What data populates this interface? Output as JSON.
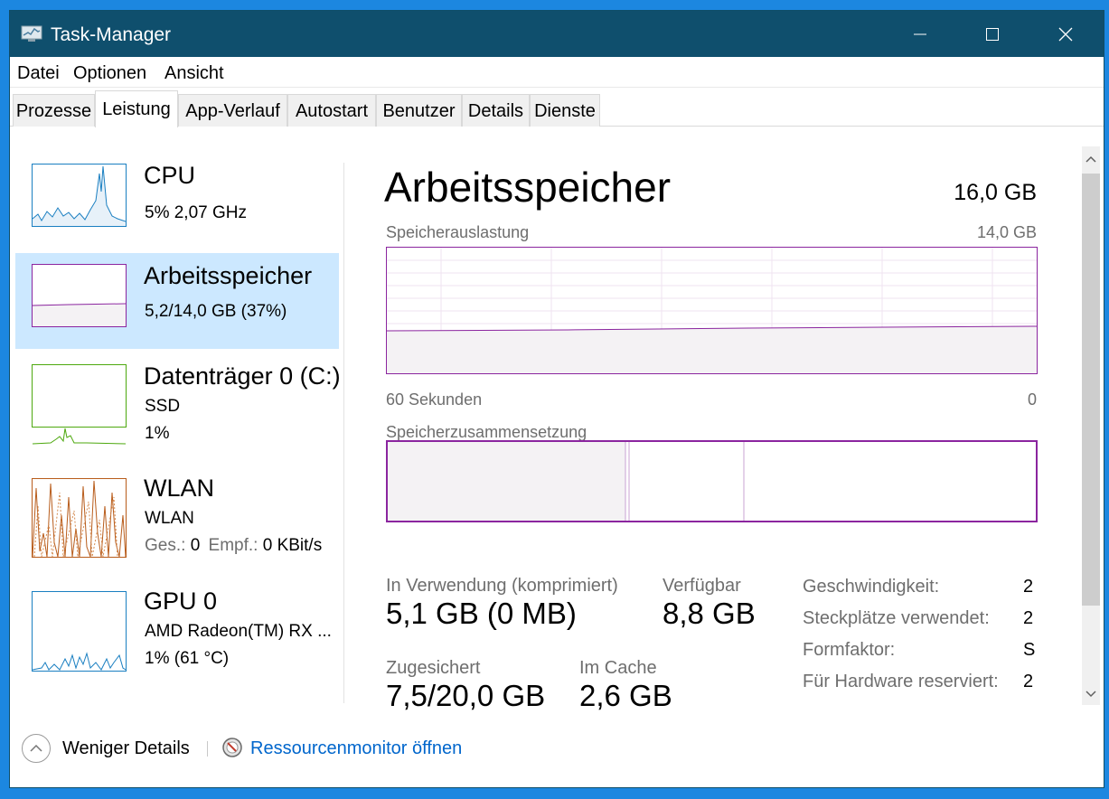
{
  "window": {
    "title": "Task-Manager"
  },
  "menu": [
    "Datei",
    "Optionen",
    "Ansicht"
  ],
  "tabs": [
    "Prozesse",
    "Leistung",
    "App-Verlauf",
    "Autostart",
    "Benutzer",
    "Details",
    "Dienste"
  ],
  "active_tab": "Leistung",
  "sidebar": [
    {
      "title": "CPU",
      "line1": "5%  2,07 GHz",
      "color": "#1a7fc1"
    },
    {
      "title": "Arbeitsspeicher",
      "line1": "5,2/14,0 GB (37%)",
      "color": "#8b259f"
    },
    {
      "title": "Datenträger 0 (C:)",
      "line1": "SSD",
      "line2": "1%",
      "color": "#4da80e"
    },
    {
      "title": "WLAN",
      "line1": "WLAN",
      "line2_a": "Ges.:",
      "line2_b": "0",
      "line2_c": "Empf.:",
      "line2_d": "0 KBit/s",
      "color": "#b85c1b"
    },
    {
      "title": "GPU 0",
      "line1": "AMD Radeon(TM) RX ...",
      "line2": "1% (61 °C)",
      "color": "#1a7fc1"
    }
  ],
  "main": {
    "title": "Arbeitsspeicher",
    "total": "16,0 GB",
    "usage_label": "Speicherauslastung",
    "usage_max": "14,0 GB",
    "axis_left": "60 Sekunden",
    "axis_right": "0",
    "composition_label": "Speicherzusammensetzung",
    "stats": {
      "in_use_label": "In Verwendung (komprimiert)",
      "in_use_value": "5,1 GB (0 MB)",
      "available_label": "Verfügbar",
      "available_value": "8,8 GB",
      "committed_label": "Zugesichert",
      "committed_value": "7,5/20,0 GB",
      "cached_label": "Im Cache",
      "cached_value": "2,6 GB"
    },
    "properties": [
      {
        "label": "Geschwindigkeit:",
        "value": "2"
      },
      {
        "label": "Steckplätze verwendet:",
        "value": "2"
      },
      {
        "label": "Formfaktor:",
        "value": "S"
      },
      {
        "label": "Für Hardware reserviert:",
        "value": "2"
      }
    ]
  },
  "footer": {
    "fewer_details": "Weniger Details",
    "resource_monitor": "Ressourcenmonitor öffnen"
  }
}
